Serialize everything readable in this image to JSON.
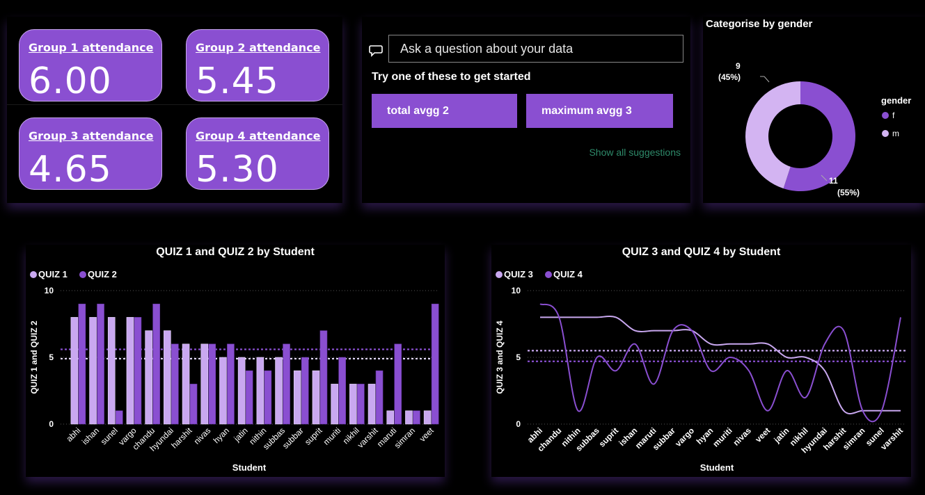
{
  "cards": [
    {
      "title": "Group 1 attendance",
      "value": "6.00"
    },
    {
      "title": "Group 2 attendance",
      "value": "5.45"
    },
    {
      "title": "Group 3 attendance",
      "value": "4.65"
    },
    {
      "title": "Group 4 attendance",
      "value": "5.30"
    }
  ],
  "qa": {
    "placeholder": "Ask a question about your data",
    "try_label": "Try one of these to get started",
    "suggestions": [
      "total avgg 2",
      "maximum avgg 3"
    ],
    "show_all": "Show all suggestions"
  },
  "colors": {
    "light": "#c9a8f0",
    "dark": "#8a4fd1",
    "accent_green": "#2e8a6a"
  },
  "chart_data": [
    {
      "type": "pie",
      "title": "Categorise by gender",
      "legend_title": "gender",
      "slices": [
        {
          "label": "f",
          "value": 11,
          "data_label": "11",
          "pct_label": "(55%)",
          "color": "#8a4fd1"
        },
        {
          "label": "m",
          "value": 9,
          "data_label": "9",
          "pct_label": "(45%)",
          "color": "#d3b4f2"
        }
      ]
    },
    {
      "type": "bar",
      "title": "QUIZ 1 and QUIZ 2 by Student",
      "xlabel": "Student",
      "ylabel": "QUIZ 1 and QUIZ 2",
      "ylim": [
        0,
        10
      ],
      "yticks": [
        "0",
        "5",
        "10"
      ],
      "categories": [
        "abhi",
        "ishan",
        "sunel",
        "vargo",
        "chandu",
        "hyundai",
        "harshit",
        "nivas",
        "hyan",
        "jatin",
        "nithin",
        "subbas",
        "subbar",
        "suprit",
        "muriti",
        "nikhil",
        "varshit",
        "maruti",
        "simran",
        "veet"
      ],
      "series": [
        {
          "name": "QUIZ 1",
          "color": "#c9a8f0",
          "values": [
            8,
            8,
            8,
            8,
            7,
            7,
            6,
            6,
            5,
            5,
            5,
            5,
            4,
            4,
            3,
            3,
            3,
            1,
            1,
            1
          ]
        },
        {
          "name": "QUIZ 2",
          "color": "#8a4fd1",
          "values": [
            9,
            9,
            1,
            8,
            9,
            6,
            3,
            6,
            6,
            4,
            4,
            6,
            5,
            7,
            5,
            3,
            4,
            6,
            1,
            9
          ]
        }
      ],
      "reference_lines": [
        {
          "value": 5.6,
          "color": "#8a4fd1"
        },
        {
          "value": 4.9,
          "color": "#e6dcff"
        }
      ]
    },
    {
      "type": "line",
      "title": "QUIZ 3 and QUIZ 4 by Student",
      "xlabel": "Student",
      "ylabel": "QUIZ 3 and QUIZ 4",
      "ylim": [
        0,
        10
      ],
      "yticks": [
        "0",
        "5",
        "10"
      ],
      "categories": [
        "abhi",
        "chandu",
        "nithin",
        "subbas",
        "suprit",
        "ishan",
        "maruti",
        "subbar",
        "vargo",
        "hyan",
        "muriti",
        "nivas",
        "veet",
        "jatin",
        "nikhil",
        "hyundai",
        "harshit",
        "simran",
        "sunel",
        "varshit"
      ],
      "series": [
        {
          "name": "QUIZ 3",
          "color": "#c9a8f0",
          "values": [
            8,
            8,
            8,
            8,
            8,
            7,
            7,
            7,
            7,
            6,
            6,
            6,
            6,
            5,
            5,
            4,
            1,
            1,
            1,
            1
          ]
        },
        {
          "name": "QUIZ 4",
          "color": "#8a4fd1",
          "values": [
            9,
            8,
            1,
            5,
            4,
            6,
            3,
            7,
            7,
            4,
            5,
            4,
            1,
            4,
            2,
            6,
            7,
            1,
            1,
            8
          ]
        }
      ],
      "reference_lines": [
        {
          "value": 5.5,
          "color": "#c9a8f0"
        },
        {
          "value": 4.7,
          "color": "#8a4fd1"
        }
      ]
    }
  ]
}
